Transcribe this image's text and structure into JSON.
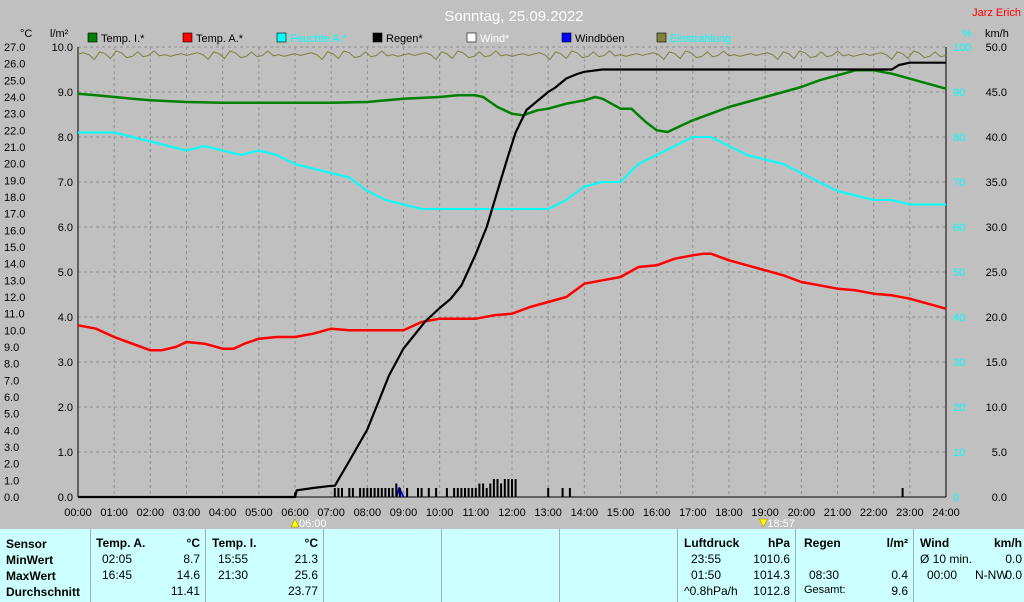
{
  "title": "Sonntag, 25.09.2022",
  "author": "Jarz Erich",
  "colors": {
    "background": "#c0c0c0",
    "temp_inside": "#008000",
    "temp_outside": "#ff0000",
    "humidity": "#00ffff",
    "rain": "#000000",
    "wind": "#ffffff",
    "gust": "#0000ff",
    "irradiance": "#808040",
    "stats_bg": "#ccffff"
  },
  "legend": [
    {
      "label": "Temp. I.*",
      "color": "#008000"
    },
    {
      "label": "Temp. A.*",
      "color": "#ff0000"
    },
    {
      "label": "Feuchte A.*",
      "color": "#00ffff"
    },
    {
      "label": "Regen*",
      "color": "#000000"
    },
    {
      "label": "Wind*",
      "color": "#ffffff"
    },
    {
      "label": "Windböen",
      "color": "#0000ff"
    },
    {
      "label": "Einstrahlung",
      "color": "#808040"
    }
  ],
  "axes": {
    "temp_unit": "°C",
    "rain_unit": "l/m²",
    "humidity_unit": "%",
    "wind_unit": "km/h",
    "temp_ticks": [
      "27.0",
      "26.0",
      "25.0",
      "24.0",
      "23.0",
      "22.0",
      "21.0",
      "20.0",
      "19.0",
      "18.0",
      "17.0",
      "16.0",
      "15.0",
      "14.0",
      "13.0",
      "12.0",
      "11.0",
      "10.0",
      "9.0",
      "8.0",
      "7.0",
      "6.0",
      "5.0",
      "4.0",
      "3.0",
      "2.0",
      "1.0",
      "0.0"
    ],
    "rain_ticks": [
      "10.0",
      "9.0",
      "8.0",
      "7.0",
      "6.0",
      "5.0",
      "4.0",
      "3.0",
      "2.0",
      "1.0",
      "0.0"
    ],
    "humidity_ticks": [
      "100",
      "90",
      "80",
      "70",
      "60",
      "50",
      "40",
      "30",
      "20",
      "10",
      "0"
    ],
    "wind_ticks": [
      "50.0",
      "45.0",
      "40.0",
      "35.0",
      "30.0",
      "25.0",
      "20.0",
      "15.0",
      "10.0",
      "5.0",
      "0.0"
    ],
    "time_ticks": [
      "00:00",
      "01:00",
      "02:00",
      "03:00",
      "04:00",
      "05:00",
      "06:00",
      "07:00",
      "08:00",
      "09:00",
      "10:00",
      "11:00",
      "12:00",
      "13:00",
      "14:00",
      "15:00",
      "16:00",
      "17:00",
      "18:00",
      "19:00",
      "20:00",
      "21:00",
      "22:00",
      "23:00",
      "24:00"
    ],
    "sunrise": "06:00",
    "sunset": "18:57"
  },
  "chart_data": {
    "type": "line",
    "x_unit": "hour",
    "temp_range": [
      0,
      27
    ],
    "rain_range": [
      0,
      10
    ],
    "humidity_range": [
      0,
      100
    ],
    "wind_range": [
      0,
      50
    ],
    "series": [
      {
        "name": "Temp. A.*",
        "axis": "temp",
        "points": [
          [
            0,
            10.3
          ],
          [
            0.5,
            10.1
          ],
          [
            1,
            9.6
          ],
          [
            1.5,
            9.2
          ],
          [
            2,
            8.8
          ],
          [
            2.3,
            8.8
          ],
          [
            2.7,
            9.0
          ],
          [
            3,
            9.3
          ],
          [
            3.5,
            9.2
          ],
          [
            4,
            8.9
          ],
          [
            4.3,
            8.9
          ],
          [
            4.6,
            9.2
          ],
          [
            5,
            9.5
          ],
          [
            5.5,
            9.6
          ],
          [
            6,
            9.6
          ],
          [
            6.5,
            9.8
          ],
          [
            7,
            10.1
          ],
          [
            7.5,
            10.0
          ],
          [
            8,
            10.0
          ],
          [
            8.5,
            10.0
          ],
          [
            9,
            10.0
          ],
          [
            9.5,
            10.5
          ],
          [
            10,
            10.7
          ],
          [
            10.5,
            10.7
          ],
          [
            11,
            10.7
          ],
          [
            11.5,
            10.9
          ],
          [
            12,
            11.0
          ],
          [
            12.5,
            11.4
          ],
          [
            13,
            11.7
          ],
          [
            13.5,
            12.0
          ],
          [
            14,
            12.8
          ],
          [
            14.5,
            13.0
          ],
          [
            15,
            13.2
          ],
          [
            15.5,
            13.8
          ],
          [
            16,
            13.9
          ],
          [
            16.5,
            14.3
          ],
          [
            17,
            14.5
          ],
          [
            17.3,
            14.6
          ],
          [
            17.5,
            14.6
          ],
          [
            18,
            14.2
          ],
          [
            18.5,
            13.9
          ],
          [
            19,
            13.6
          ],
          [
            19.5,
            13.3
          ],
          [
            20,
            12.9
          ],
          [
            20.5,
            12.7
          ],
          [
            21,
            12.5
          ],
          [
            21.5,
            12.4
          ],
          [
            22,
            12.2
          ],
          [
            22.5,
            12.1
          ],
          [
            23,
            11.9
          ],
          [
            23.5,
            11.6
          ],
          [
            24,
            11.3
          ]
        ]
      },
      {
        "name": "Temp. I.*",
        "axis": "temp",
        "points": [
          [
            0,
            24.2
          ],
          [
            0.5,
            24.1
          ],
          [
            1,
            24.0
          ],
          [
            1.5,
            23.9
          ],
          [
            2,
            23.8
          ],
          [
            3,
            23.7
          ],
          [
            4,
            23.65
          ],
          [
            5,
            23.65
          ],
          [
            6,
            23.65
          ],
          [
            7,
            23.65
          ],
          [
            8,
            23.7
          ],
          [
            9,
            23.9
          ],
          [
            10,
            24.0
          ],
          [
            10.5,
            24.1
          ],
          [
            11,
            24.1
          ],
          [
            11.2,
            24.0
          ],
          [
            11.6,
            23.4
          ],
          [
            12,
            23.0
          ],
          [
            12.3,
            22.9
          ],
          [
            12.7,
            23.2
          ],
          [
            13,
            23.3
          ],
          [
            13.5,
            23.6
          ],
          [
            14,
            23.8
          ],
          [
            14.3,
            24.0
          ],
          [
            14.5,
            23.9
          ],
          [
            15,
            23.3
          ],
          [
            15.3,
            23.3
          ],
          [
            15.7,
            22.5
          ],
          [
            16,
            22.0
          ],
          [
            16.3,
            21.9
          ],
          [
            16.7,
            22.3
          ],
          [
            17,
            22.6
          ],
          [
            17.5,
            23.0
          ],
          [
            18,
            23.4
          ],
          [
            18.5,
            23.7
          ],
          [
            19,
            24.0
          ],
          [
            19.5,
            24.3
          ],
          [
            20,
            24.6
          ],
          [
            20.5,
            25.0
          ],
          [
            21,
            25.3
          ],
          [
            21.5,
            25.6
          ],
          [
            22,
            25.6
          ],
          [
            22.5,
            25.4
          ],
          [
            23,
            25.1
          ],
          [
            23.5,
            24.8
          ],
          [
            24,
            24.5
          ]
        ]
      },
      {
        "name": "Feuchte A.*",
        "axis": "humidity",
        "points": [
          [
            0,
            81
          ],
          [
            1,
            81
          ],
          [
            1.5,
            80
          ],
          [
            2,
            79
          ],
          [
            2.5,
            78
          ],
          [
            3,
            77
          ],
          [
            3.5,
            78
          ],
          [
            4,
            77
          ],
          [
            4.5,
            76
          ],
          [
            5,
            77
          ],
          [
            5.5,
            76
          ],
          [
            6,
            74
          ],
          [
            6.5,
            73
          ],
          [
            7,
            72
          ],
          [
            7.5,
            71
          ],
          [
            8,
            68
          ],
          [
            8.5,
            66
          ],
          [
            9,
            65
          ],
          [
            9.5,
            64
          ],
          [
            10,
            64
          ],
          [
            11,
            64
          ],
          [
            12,
            64
          ],
          [
            13,
            64
          ],
          [
            13.5,
            66
          ],
          [
            14,
            69
          ],
          [
            14.5,
            70
          ],
          [
            15,
            70
          ],
          [
            15.5,
            74
          ],
          [
            16,
            76
          ],
          [
            16.5,
            78
          ],
          [
            17,
            80
          ],
          [
            17.5,
            80
          ],
          [
            18,
            78
          ],
          [
            18.5,
            76
          ],
          [
            19,
            75
          ],
          [
            19.5,
            74
          ],
          [
            20,
            72
          ],
          [
            20.5,
            70
          ],
          [
            21,
            68
          ],
          [
            21.5,
            67
          ],
          [
            22,
            66
          ],
          [
            22.5,
            66
          ],
          [
            23,
            65
          ],
          [
            23.5,
            65
          ],
          [
            24,
            65
          ]
        ]
      },
      {
        "name": "Regen*",
        "axis": "rain",
        "points": [
          [
            0,
            0
          ],
          [
            6,
            0
          ],
          [
            6.05,
            0.15
          ],
          [
            6.5,
            0.2
          ],
          [
            7,
            0.25
          ],
          [
            7.1,
            0.25
          ],
          [
            7.5,
            0.8
          ],
          [
            8,
            1.5
          ],
          [
            8.3,
            2.1
          ],
          [
            8.6,
            2.7
          ],
          [
            9,
            3.3
          ],
          [
            9.3,
            3.6
          ],
          [
            9.6,
            3.9
          ],
          [
            10,
            4.2
          ],
          [
            10.3,
            4.4
          ],
          [
            10.6,
            4.7
          ],
          [
            11,
            5.4
          ],
          [
            11.3,
            6.0
          ],
          [
            11.6,
            6.8
          ],
          [
            11.9,
            7.6
          ],
          [
            12.1,
            8.1
          ],
          [
            12.4,
            8.6
          ],
          [
            12.7,
            8.8
          ],
          [
            13,
            9.0
          ],
          [
            13.2,
            9.1
          ],
          [
            13.5,
            9.3
          ],
          [
            13.8,
            9.4
          ],
          [
            14,
            9.45
          ],
          [
            14.5,
            9.5
          ],
          [
            16,
            9.5
          ],
          [
            19,
            9.5
          ],
          [
            21,
            9.5
          ],
          [
            22.5,
            9.5
          ],
          [
            22.7,
            9.6
          ],
          [
            23,
            9.65
          ],
          [
            24,
            9.65
          ]
        ]
      },
      {
        "name": "Windböen",
        "axis": "wind",
        "points": [
          [
            8.8,
            0
          ],
          [
            8.88,
            1.0
          ],
          [
            9.0,
            0
          ]
        ]
      }
    ],
    "rain_bars_hours": [
      6.0,
      7.1,
      7.2,
      7.3,
      7.5,
      7.6,
      7.8,
      7.9,
      8.0,
      8.1,
      8.2,
      8.3,
      8.4,
      8.5,
      8.6,
      8.7,
      8.8,
      8.9,
      9.1,
      9.4,
      9.5,
      9.7,
      9.9,
      10.2,
      10.4,
      10.5,
      10.6,
      10.7,
      10.8,
      10.9,
      11.0,
      11.1,
      11.2,
      11.3,
      11.4,
      11.5,
      11.6,
      11.7,
      11.8,
      11.9,
      12.0,
      12.1,
      13.0,
      13.4,
      13.6,
      22.8
    ],
    "rain_bars_values": [
      0.1,
      0.2,
      0.2,
      0.2,
      0.2,
      0.2,
      0.2,
      0.2,
      0.2,
      0.2,
      0.2,
      0.2,
      0.2,
      0.2,
      0.2,
      0.2,
      0.3,
      0.2,
      0.2,
      0.2,
      0.2,
      0.2,
      0.2,
      0.2,
      0.2,
      0.2,
      0.2,
      0.2,
      0.2,
      0.2,
      0.2,
      0.3,
      0.3,
      0.2,
      0.3,
      0.4,
      0.4,
      0.3,
      0.4,
      0.4,
      0.4,
      0.4,
      0.2,
      0.2,
      0.2,
      0.2
    ]
  },
  "stats": {
    "sensor": {
      "header": "Sensor",
      "rows": [
        "MinWert",
        "MaxWert",
        "Durchschnitt"
      ]
    },
    "temp_a": {
      "header": "Temp. A.",
      "unit": "°C",
      "min_time": "02:05",
      "min": "8.7",
      "max_time": "16:45",
      "max": "14.6",
      "avg": "11.41"
    },
    "temp_i": {
      "header": "Temp. I.",
      "unit": "°C",
      "min_time": "15:55",
      "min": "21.3",
      "max_time": "21:30",
      "max": "25.6",
      "avg": "23.77"
    },
    "pressure": {
      "header": "Luftdruck",
      "unit": "hPa",
      "min_time": "23:55",
      "min": "1010.6",
      "max_time": "01:50",
      "max": "1014.3",
      "trend": "^0.8hPa/h",
      "avg": "1012.8"
    },
    "rain": {
      "header": "Regen",
      "unit": "l/m²",
      "max_time": "08:30",
      "max": "0.4",
      "total_label": "Gesamt:",
      "total": "9.6"
    },
    "wind": {
      "header": "Wind",
      "unit": "km/h",
      "min_label": "Ø 10 min.",
      "min": "0.0",
      "max_time": "00:00",
      "max_dir": "N-NW",
      "max": "0.0"
    }
  }
}
